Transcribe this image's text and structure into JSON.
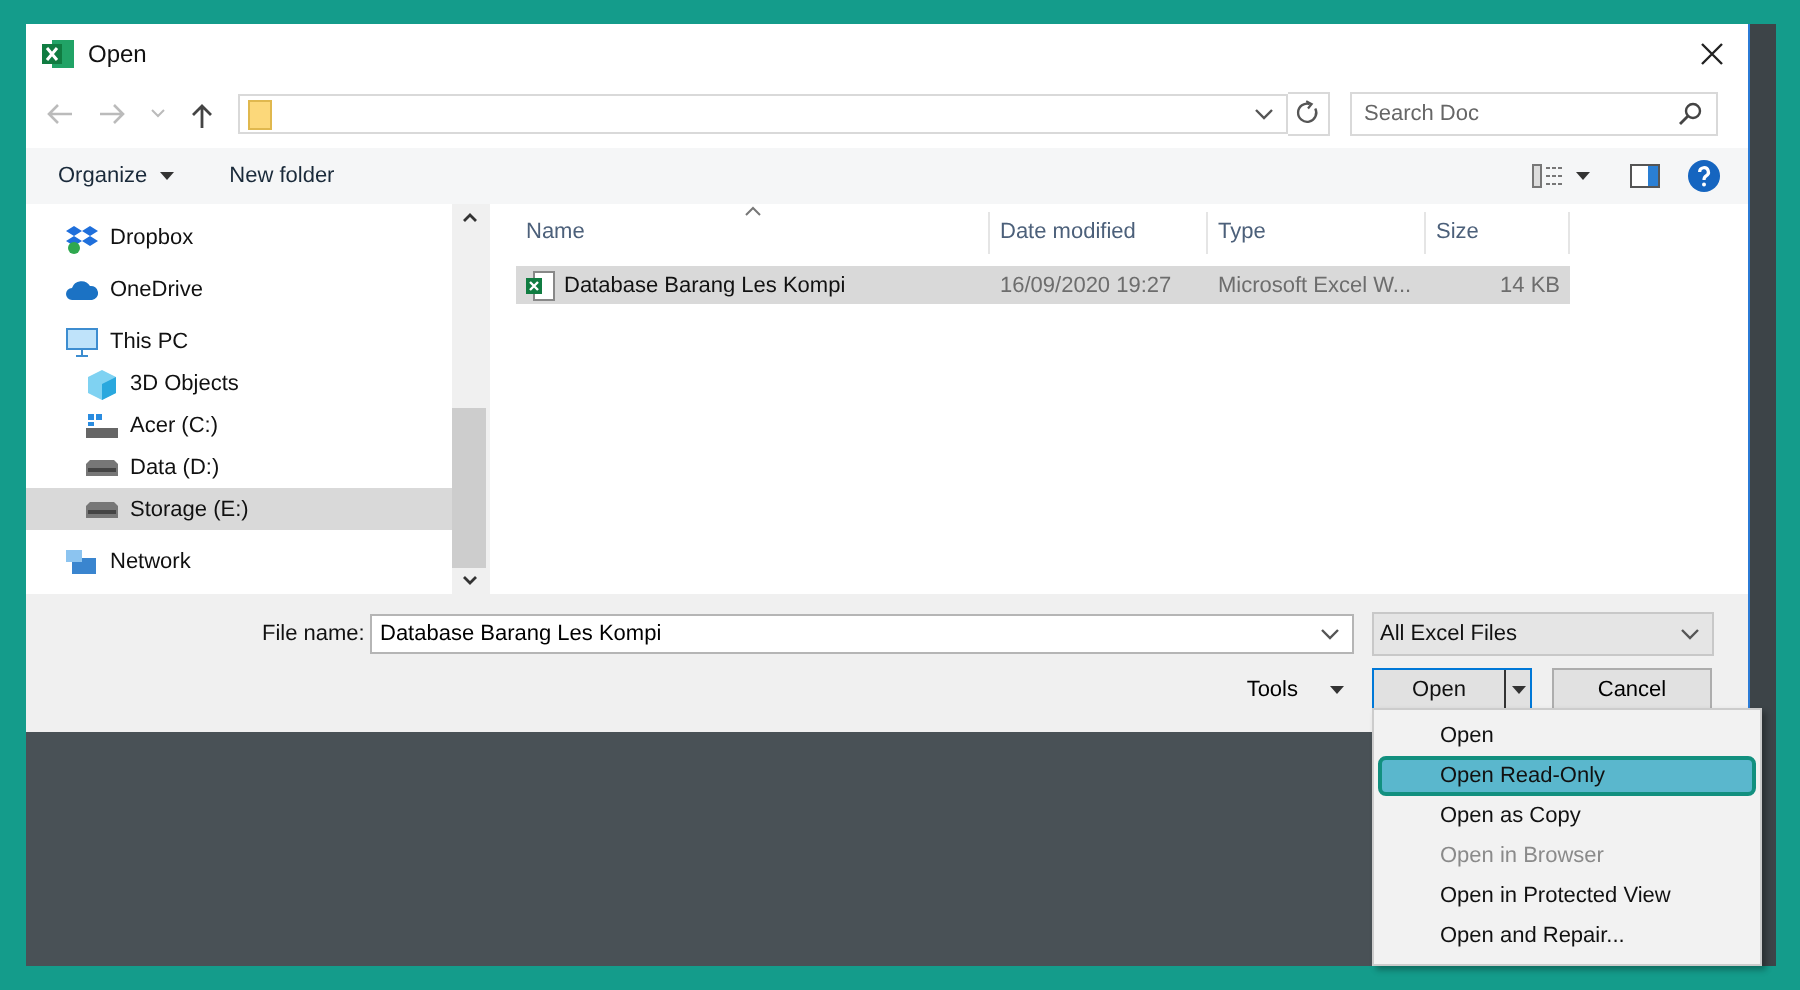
{
  "window": {
    "title": "Open"
  },
  "search": {
    "placeholder": "Search Doc"
  },
  "toolbar": {
    "organize": "Organize",
    "new_folder": "New folder"
  },
  "sidebar": {
    "items": [
      {
        "label": "Dropbox",
        "kind": "dropbox",
        "selected": false
      },
      {
        "label": "OneDrive",
        "kind": "cloud",
        "selected": false
      },
      {
        "label": "This PC",
        "kind": "pc",
        "selected": false,
        "children": [
          {
            "label": "3D Objects",
            "kind": "cube",
            "selected": false
          },
          {
            "label": "Acer (C:)",
            "kind": "system-drive",
            "selected": false
          },
          {
            "label": "Data (D:)",
            "kind": "drive",
            "selected": false
          },
          {
            "label": "Storage (E:)",
            "kind": "drive",
            "selected": true
          }
        ]
      },
      {
        "label": "Network",
        "kind": "network",
        "selected": false
      }
    ]
  },
  "file_list": {
    "columns": [
      {
        "label": "Name",
        "sorted": true
      },
      {
        "label": "Date modified",
        "sorted": false
      },
      {
        "label": "Type",
        "sorted": false
      },
      {
        "label": "Size",
        "sorted": false
      }
    ],
    "rows": [
      {
        "name": "Database Barang Les Kompi",
        "date": "16/09/2020 19:27",
        "type": "Microsoft Excel W...",
        "size": "14 KB",
        "selected": true
      }
    ]
  },
  "file_name": {
    "label": "File name:",
    "value": "Database Barang Les Kompi"
  },
  "file_type": {
    "value": "All Excel Files"
  },
  "tools": {
    "label": "Tools"
  },
  "buttons": {
    "open": "Open",
    "cancel": "Cancel"
  },
  "open_menu": {
    "items": [
      {
        "label": "Open",
        "selected": false,
        "disabled": false
      },
      {
        "label": "Open Read-Only",
        "selected": true,
        "disabled": false
      },
      {
        "label": "Open as Copy",
        "selected": false,
        "disabled": false
      },
      {
        "label": "Open in Browser",
        "selected": false,
        "disabled": true
      },
      {
        "label": "Open in Protected View",
        "selected": false,
        "disabled": false
      },
      {
        "label": "Open and Repair...",
        "selected": false,
        "disabled": false
      }
    ]
  }
}
